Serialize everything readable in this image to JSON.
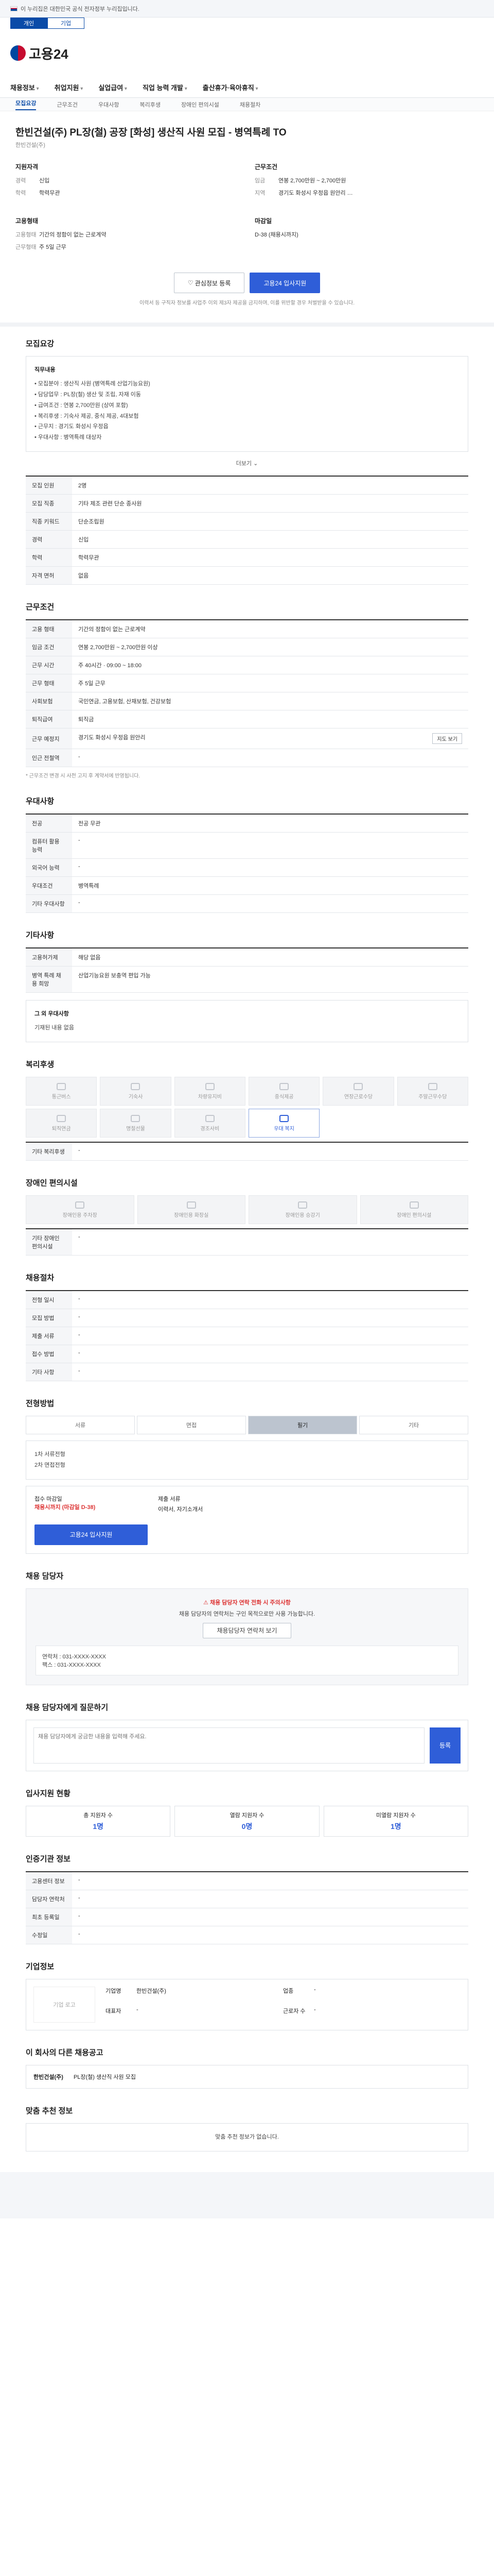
{
  "gov": {
    "notice": "이 누리집은 대한민국 공식 전자정부 누리집입니다."
  },
  "tabs": [
    "개인",
    "기업"
  ],
  "logo": "고용24",
  "nav": [
    "채용정보",
    "취업지원",
    "실업급여",
    "직업 능력 개발",
    "출산휴가·육아휴직"
  ],
  "subnav": [
    "모집요강",
    "근무조건",
    "우대사항",
    "복리후생",
    "장애인 편의시설",
    "채용절차"
  ],
  "job": {
    "title": "한빈건설(주) PL장(철) 공장 [화성] 생산직 사원 모집 - 병역특례 TO",
    "company": "한빈건설(주)",
    "qual_title": "지원자격",
    "qual": [
      [
        "경력",
        "신입"
      ],
      [
        "학력",
        "학력무관"
      ]
    ],
    "cond_title": "근무조건",
    "cond": [
      [
        "임금",
        "연봉 2,700만원 ~ 2,700만원"
      ],
      [
        "지역",
        "경기도 화성시 우정읍 원안리 …"
      ]
    ],
    "contract_title": "고용형태",
    "contract": [
      [
        "고용형태",
        "기간의 정함이 없는 근로계약"
      ],
      [
        "근무형태",
        "주 5일 근무"
      ]
    ],
    "deadline_title": "마감일",
    "deadline": "D-38 (채용시까지)"
  },
  "buttons": {
    "scrap": "관심정보 등록",
    "apply": "고용24 입사지원"
  },
  "notice": "이력서 등 구직자 정보를 사업주 이외 제3자 제공을 금지하며, 이를 위반할 경우 처벌받을 수 있습니다.",
  "sections": {
    "recruit": "모집요강",
    "work": "근무조건",
    "pref": "우대사항",
    "etc": "기타사항",
    "welfare": "복리후생",
    "facility": "장애인 편의시설",
    "process": "채용절차",
    "method": "전형방법",
    "manager": "채용 담당자",
    "qna": "채용 담당자에게 질문하기",
    "stats": "입사지원 현황",
    "info": "인증기관 정보",
    "corp": "기업정보",
    "other": "이 회사의 다른 채용공고",
    "suggest": "맞춤 추천 정보"
  },
  "recruit": {
    "box_title": "직무내용",
    "lines": [
      "• 모집분야 : 생산직 사원 (병역특례 산업기능요원)",
      "• 담당업무 : PL장(철) 생산 및 조립, 자재 이동",
      "• 급여조건 : 연봉 2,700만원 (상여 포함)",
      "• 복리후생 : 기숙사 제공, 중식 제공, 4대보험",
      "• 근무지 : 경기도 화성시 우정읍",
      "• 우대사항 : 병역특례 대상자"
    ],
    "more": "더보기",
    "rows": [
      [
        "모집 인원",
        "2명"
      ],
      [
        "모집 직종",
        "기타 제조 관련 단순 종사원"
      ],
      [
        "직종 키워드",
        "단순조립원"
      ],
      [
        "경력",
        "신입"
      ],
      [
        "학력",
        "학력무관"
      ],
      [
        "자격 면허",
        "없음"
      ]
    ]
  },
  "work": {
    "rows": [
      [
        "고용 형태",
        "기간의 정함이 없는 근로계약"
      ],
      [
        "임금 조건",
        "연봉 2,700만원 ~ 2,700만원 이상"
      ],
      [
        "근무 시간",
        "주 40시간 · 09:00 ~ 18:00"
      ],
      [
        "근무 형태",
        "주 5일 근무"
      ],
      [
        "사회보험",
        "국민연금, 고용보험, 산재보험, 건강보험"
      ],
      [
        "퇴직급여",
        "퇴직금"
      ],
      [
        "근무 예정지",
        "경기도 화성시 우정읍 원안리"
      ],
      [
        "인근 전철역",
        "-"
      ]
    ],
    "map_btn": "지도 보기",
    "note": "* 근무조건 변경 시 사전 고지 후 계약서에 반영됩니다."
  },
  "pref": {
    "rows": [
      [
        "전공",
        "전공 무관"
      ],
      [
        "컴퓨터 활용 능력",
        "-"
      ],
      [
        "외국어 능력",
        "-"
      ],
      [
        "우대조건",
        "병역특례"
      ],
      [
        "기타 우대사항",
        "-"
      ]
    ]
  },
  "etc": {
    "rows": [
      [
        "고용허가제",
        "해당 없음"
      ],
      [
        "병역 특례 채용 희망",
        "산업기능요원 보충역 편입 가능"
      ]
    ],
    "box_title": "그 외 우대사항",
    "box_text": "기재된 내용 없음"
  },
  "welfare": {
    "items": [
      "통근버스",
      "기숙사",
      "차량유지비",
      "중식제공",
      "연장근로수당",
      "주말근무수당",
      "퇴직연금",
      "명절선물",
      "경조사비",
      "우대 복지"
    ],
    "etc_label": "기타 복리후생",
    "etc_value": "-"
  },
  "facility": {
    "items": [
      "장애인용 주차장",
      "장애인용 화장실",
      "장애인용 승강기",
      "장애인 편의시설"
    ],
    "etc_label": "기타 장애인 편의시설",
    "etc_value": "-"
  },
  "process": {
    "rows": [
      [
        "전형 일시",
        "-"
      ],
      [
        "모집 방법",
        "-"
      ],
      [
        "제출 서류",
        "-"
      ],
      [
        "접수 방법",
        "-"
      ],
      [
        "기타 사항",
        "-"
      ]
    ]
  },
  "method": {
    "steps": [
      "서류",
      "면접",
      "필기",
      "기타"
    ],
    "desc": [
      "1차 서류전형",
      "2차 면접전형"
    ],
    "deadline_label": "접수 마감일",
    "deadline_value": "채용시까지 (마감일 D-38)",
    "doc_label": "제출 서류",
    "doc_value": "이력서, 자기소개서",
    "apply": "고용24 입사지원"
  },
  "manager": {
    "warn": "채용 담당자 연락 전화 시 주의사항",
    "text": "채용 담당자의 연락처는 구인 목적으로만 사용 가능합니다.",
    "btn": "채용담당자 연락처 보기",
    "rows": [
      [
        "연락처",
        "031-XXXX-XXXX"
      ],
      [
        "팩스",
        "031-XXXX-XXXX"
      ]
    ]
  },
  "qna": {
    "placeholder": "채용 담당자에게 궁금한 내용을 입력해 주세요.",
    "send": "등록"
  },
  "stats": [
    [
      "총 지원자 수",
      "1명"
    ],
    [
      "열람 지원자 수",
      "0명"
    ],
    [
      "미열람 지원자 수",
      "1명"
    ]
  ],
  "info": {
    "rows": [
      [
        "고용센터 정보",
        "-"
      ],
      [
        "담당자 연락처",
        "-"
      ],
      [
        "최초 등록일",
        "-"
      ],
      [
        "수정일",
        "-"
      ]
    ]
  },
  "corp": {
    "logo": "기업 로고",
    "rows": [
      [
        "기업명",
        "한빈건설(주)"
      ],
      [
        "업종",
        "-"
      ],
      [
        "대표자",
        "-"
      ],
      [
        "근로자 수",
        "-"
      ]
    ]
  },
  "other": {
    "name": "한빈건설(주)",
    "text": "PL장(철) 생산직 사원 모집"
  },
  "suggest": {
    "text": "맞춤 추천 정보가 없습니다."
  }
}
